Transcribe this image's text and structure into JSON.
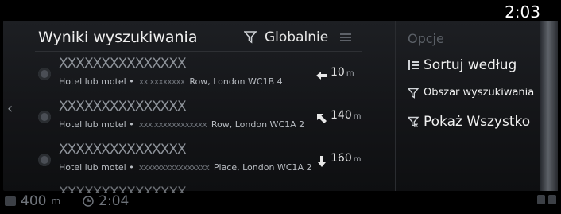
{
  "status_bar": {
    "clock": "2:03"
  },
  "header": {
    "title": "Wyniki wyszukiwania",
    "filter_label": "Globalnie"
  },
  "results": [
    {
      "name": "XXXXXXXXXXXXXXX",
      "category": "Hotel lub motel •",
      "hidden": "xx xxxxxxxx",
      "address": "Row, London WC1B 4",
      "distance": "10",
      "unit": "m",
      "direction_icon": "arrow-left-icon"
    },
    {
      "name": "XXXXXXXXXXXXXXX",
      "category": "Hotel lub motel •",
      "hidden": "xxx xxxxxxxxxxxx",
      "address": "Row, London WC1A 2",
      "distance": "140",
      "unit": "m",
      "direction_icon": "arrow-up-left-icon"
    },
    {
      "name": "XXXXXXXXXXXXXXX",
      "category": "Hotel lub motel •",
      "hidden": "xxxxxxxxxxxxxxxx",
      "address": "Place, London WC1A 2",
      "distance": "160",
      "unit": "m",
      "direction_icon": "arrow-down-icon"
    },
    {
      "name": "XXXXXXXXXXXXXXX",
      "category": "",
      "hidden": "",
      "address": "",
      "distance": "",
      "unit": "",
      "direction_icon": "arrow-left-icon"
    }
  ],
  "options": {
    "title": "Opcje",
    "items": [
      {
        "label": "Sortuj według",
        "icon": "sort-icon"
      },
      {
        "label": "Obszar wyszukiwania",
        "icon": "filter-icon"
      },
      {
        "label": "Pokaż Wszystko",
        "icon": "filter-clear-icon"
      }
    ]
  },
  "footer": {
    "distance": "400",
    "distance_unit": "m",
    "eta": "2:04"
  },
  "colors": {
    "background": "#000000",
    "panel": "#1a1c20",
    "text": "#e8e8e8",
    "muted": "#6f747b"
  }
}
